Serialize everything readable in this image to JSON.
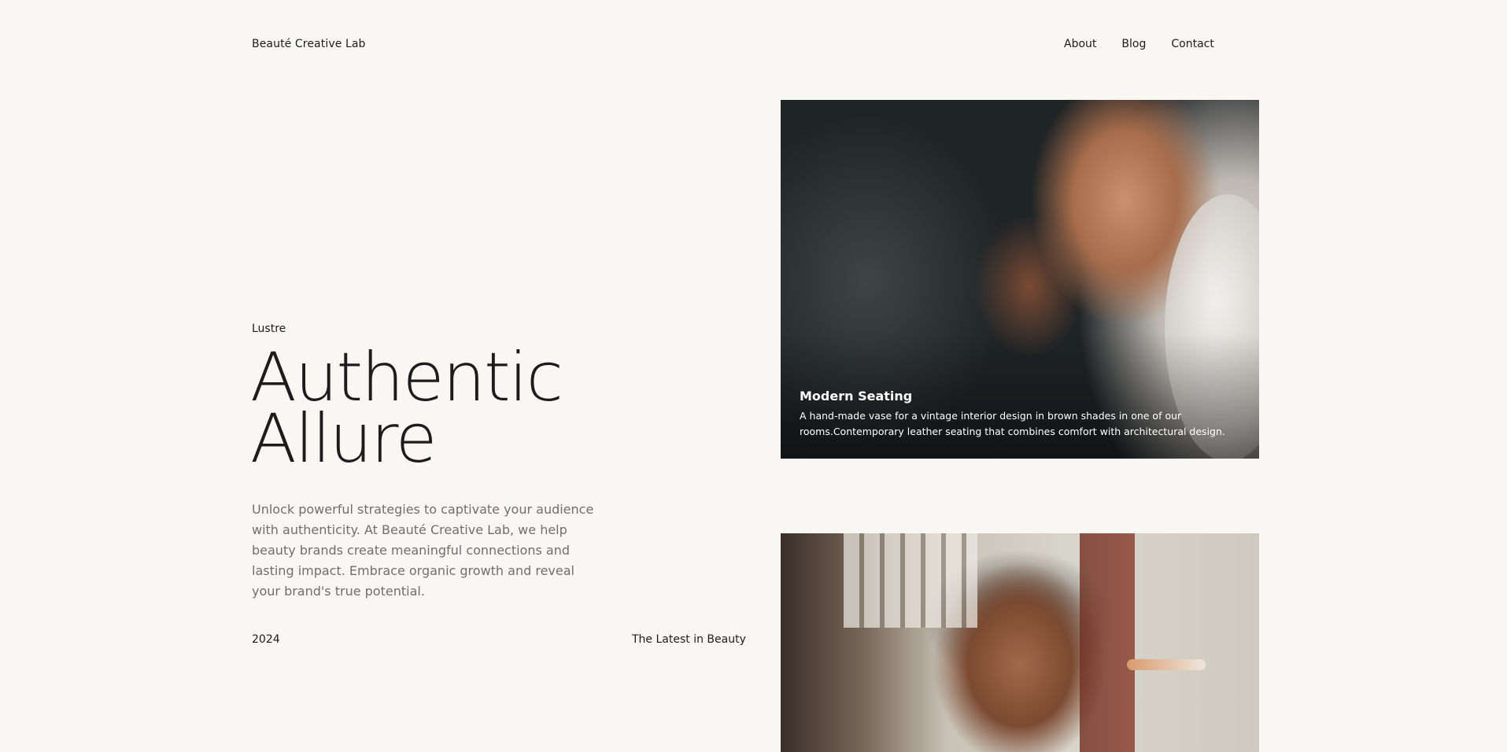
{
  "header": {
    "brand": "Beauté Creative Lab",
    "nav": [
      "About",
      "Blog",
      "Contact"
    ]
  },
  "hero": {
    "eyebrow": "Lustre",
    "headline_line1": "Authentic",
    "headline_line2": "Allure",
    "intro": "Unlock powerful strategies to captivate your audience with authenticity. At Beauté Creative Lab, we help beauty brands create meaningful connections and lasting impact. Embrace organic growth and reveal your brand's true potential.",
    "year": "2024",
    "latest": "The Latest in Beauty"
  },
  "cards": [
    {
      "title": "Modern Seating",
      "description": "A hand-made vase for a vintage interior design in brown shades in one of our rooms.Contemporary leather seating that combines comfort with architectural design."
    }
  ],
  "colors": {
    "background": "#f9f7f3",
    "text": "#1c1c1c",
    "muted": "#6f6f6f"
  }
}
